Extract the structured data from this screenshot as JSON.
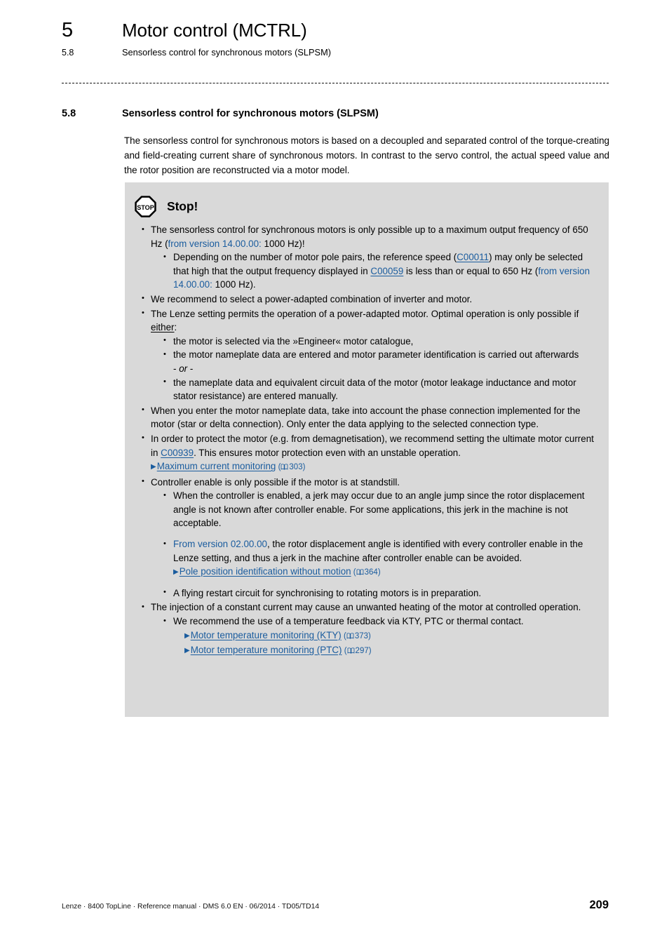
{
  "header": {
    "chapter_number": "5",
    "chapter_title": "Motor control (MCTRL)",
    "section_number": "5.8",
    "section_title": "Sensorless control for synchronous motors (SLPSM)"
  },
  "section": {
    "number": "5.8",
    "title": "Sensorless control for synchronous motors (SLPSM)",
    "intro": "The sensorless control for synchronous motors is based on a decoupled and separated control of the torque-creating and field-creating current share of synchronous motors. In contrast to the servo control, the actual speed value and the rotor position are reconstructed via a motor model."
  },
  "stop_box": {
    "icon": "stop-octagon-icon",
    "icon_label": "STOP",
    "title": "Stop!",
    "background_color": "#d9d9d9",
    "items": {
      "b1_p1": "The sensorless control for synchronous motors is only possible up to a maximum output frequency of 650 Hz (",
      "b1_blue": "from version 14.00.00:",
      "b1_p2": " 1000 Hz)!",
      "b1s1_p1": "Depending on the number of motor pole pairs, the reference speed (",
      "b1s1_link1": "C00011",
      "b1s1_p2": ") may only be selected that high that the output frequency displayed in ",
      "b1s1_link2": "C00059",
      "b1s1_p3": " is less than or equal to 650 Hz (",
      "b1s1_blue": "from version 14.00.00:",
      "b1s1_p4": " 1000 Hz).",
      "b2": "We recommend to select a power-adapted combination of inverter and motor.",
      "b3_p1": "The Lenze setting permits the operation of a power-adapted motor. Optimal operation is only possible if ",
      "b3_underlined": "either",
      "b3_p2": ":",
      "b3s1": "the motor is selected via the »Engineer« motor catalogue,",
      "b3s2": "the motor nameplate data are entered and motor parameter identification is carried out afterwards",
      "b3_or_pre": "- ",
      "b3_or_em": "or",
      "b3_or_post": " -",
      "b3s3": "the nameplate data and equivalent circuit data of the motor (motor leakage inductance and motor stator resistance) are entered manually.",
      "b4": "When you enter the motor nameplate data, take into account the phase connection implemented for the motor (star or delta connection). Only enter the data applying to the selected connection type.",
      "b5_p1": "In order to protect the motor (e.g. from demagnetisation), we recommend setting the ultimate motor current in ",
      "b5_link": "C00939",
      "b5_p2": ". This ensures motor protection even with an unstable operation.  ",
      "b5_xref_label": "Maximum current monitoring",
      "b5_xref_page": "303",
      "b6": "Controller enable is only possible if the motor is at standstill.",
      "b6s1": "When the controller is enabled, a jerk may occur due to an angle jump since the rotor displacement angle is not known after controller enable. For some applications, this jerk in the machine is not acceptable.",
      "b6s2_blue": "From version 02.00.00",
      "b6s2_p1": ", the rotor displacement angle is identified with every controller enable in the Lenze setting, and thus a jerk in the machine after controller enable can be avoided.  ",
      "b6s2_xref_label": "Pole position identification without motion",
      "b6s2_xref_page": "364",
      "b6s3": "A flying restart circuit for synchronising to rotating motors is in preparation.",
      "b7": "The injection of a constant current may cause an unwanted heating of the motor at controlled operation.",
      "b7s1": "We recommend the use of a temperature feedback via KTY, PTC or thermal contact.",
      "b7s1_xref1_label": "Motor temperature monitoring (KTY)",
      "b7s1_xref1_page": "373",
      "b7s1_xref2_label": "Motor temperature monitoring (PTC)",
      "b7s1_xref2_page": "297"
    }
  },
  "footer": {
    "imprint": "Lenze · 8400 TopLine · Reference manual · DMS 6.0 EN · 06/2014 · TD05/TD14",
    "page_number": "209"
  },
  "colors": {
    "link_blue": "#1a5c9e",
    "box_gray": "#d9d9d9",
    "text_black": "#000000"
  }
}
